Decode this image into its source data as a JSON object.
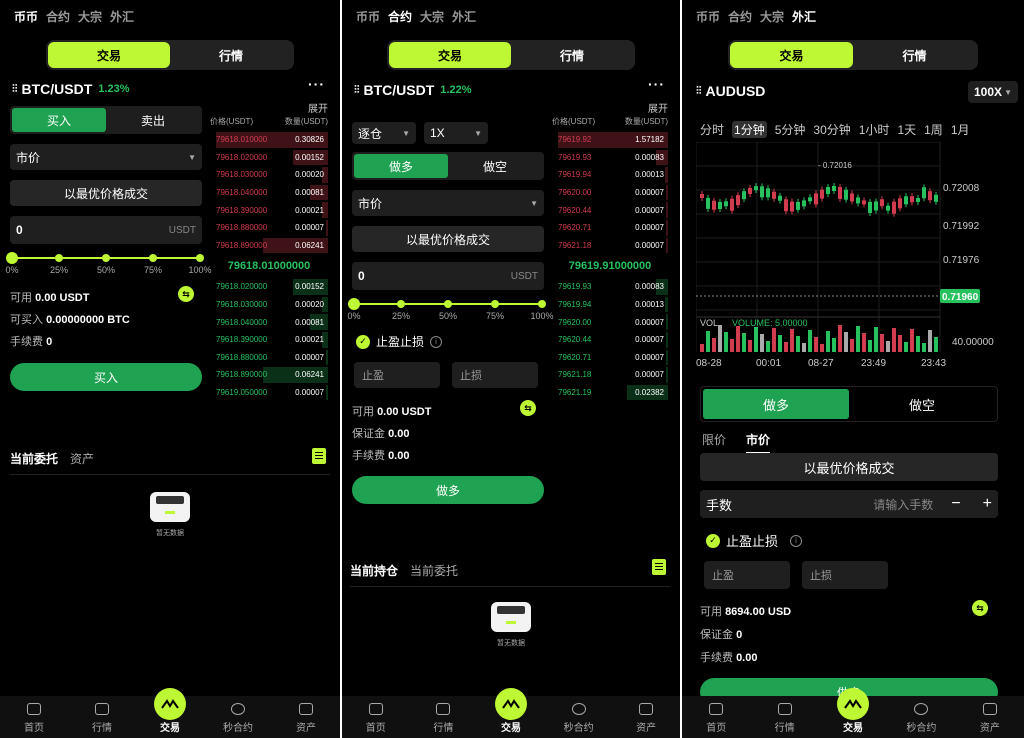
{
  "common": {
    "topnav": [
      "币币",
      "合约",
      "大宗",
      "外汇"
    ],
    "seg": [
      "交易",
      "行情"
    ],
    "bottomnav": [
      "首页",
      "行情",
      "交易",
      "秒合约",
      "资产"
    ],
    "empty_text": "暂无数据",
    "colors": {
      "accent": "#bef733",
      "buy": "#1fa251",
      "up": "#27c15e",
      "down": "#d23c4f"
    }
  },
  "spot": {
    "pair": "BTC/USDT",
    "change": "1.23%",
    "expand": "展开",
    "buy_tab": "买入",
    "sell_tab": "卖出",
    "order_type": "市价",
    "best_price": "以最优价格成交",
    "amount_value": "0",
    "amount_unit": "USDT",
    "slider_labels": [
      "0%",
      "25%",
      "50%",
      "75%",
      "100%"
    ],
    "slider_value": "0%",
    "available_label": "可用",
    "available_value": "0.00 USDT",
    "can_buy_label": "可买入",
    "can_buy_value": "0.00000000  BTC",
    "fee_label": "手续费",
    "fee_value": "0",
    "submit": "买入",
    "ob_header_price": "价格(USDT)",
    "ob_header_qty": "数量(USDT)",
    "asks": [
      {
        "p": "79618.010000",
        "q": "0.30826",
        "d": 0.95
      },
      {
        "p": "79618.020000",
        "q": "0.00152",
        "d": 0.3
      },
      {
        "p": "79618.030000",
        "q": "0.00020",
        "d": 0.05
      },
      {
        "p": "79618.040000",
        "q": "0.00081",
        "d": 0.15
      },
      {
        "p": "79618.390000",
        "q": "0.00021",
        "d": 0.05
      },
      {
        "p": "79618.880000",
        "q": "0.00007",
        "d": 0.02
      },
      {
        "p": "79618.890000",
        "q": "0.06241",
        "d": 0.55
      }
    ],
    "mid_price": "79618.01000000",
    "bids": [
      {
        "p": "79618.020000",
        "q": "0.00152",
        "d": 0.3
      },
      {
        "p": "79618.030000",
        "q": "0.00020",
        "d": 0.05
      },
      {
        "p": "79618.040000",
        "q": "0.00081",
        "d": 0.15
      },
      {
        "p": "79618.390000",
        "q": "0.00021",
        "d": 0.05
      },
      {
        "p": "79618.880000",
        "q": "0.00007",
        "d": 0.02
      },
      {
        "p": "79618.890000",
        "q": "0.06241",
        "d": 0.55
      },
      {
        "p": "79619.050000",
        "q": "0.00007",
        "d": 0.02
      }
    ],
    "sections": [
      "当前委托",
      "资产"
    ]
  },
  "contract": {
    "pair": "BTC/USDT",
    "change": "1.22%",
    "expand": "展开",
    "margin_mode": "逐仓",
    "leverage": "1X",
    "long_tab": "做多",
    "short_tab": "做空",
    "order_type": "市价",
    "best_price": "以最优价格成交",
    "amount_value": "0",
    "amount_unit": "USDT",
    "slider_labels": [
      "0%",
      "25%",
      "50%",
      "75%",
      "100%"
    ],
    "slider_value": "0%",
    "tpsl_label": "止盈止损",
    "tp_placeholder": "止盈",
    "sl_placeholder": "止损",
    "available_label": "可用",
    "available_value": "0.00 USDT",
    "margin_label": "保证金",
    "margin_value": "0.00",
    "fee_label": "手续费",
    "fee_value": "0.00",
    "submit": "做多",
    "ob_header_price": "价格(USDT)",
    "ob_header_qty": "数量(USDT)",
    "asks": [
      {
        "p": "79619.92",
        "q": "1.57182",
        "d": 0.95
      },
      {
        "p": "79619.93",
        "q": "0.00083",
        "d": 0.1
      },
      {
        "p": "79619.94",
        "q": "0.00013",
        "d": 0.03
      },
      {
        "p": "79620.00",
        "q": "0.00007",
        "d": 0.02
      },
      {
        "p": "79620.44",
        "q": "0.00007",
        "d": 0.02
      },
      {
        "p": "79620.71",
        "q": "0.00007",
        "d": 0.02
      },
      {
        "p": "79621.18",
        "q": "0.00007",
        "d": 0.02
      }
    ],
    "mid_price": "79619.91000000",
    "bids": [
      {
        "p": "79619.93",
        "q": "0.00083",
        "d": 0.1
      },
      {
        "p": "79619.94",
        "q": "0.00013",
        "d": 0.03
      },
      {
        "p": "79620.00",
        "q": "0.00007",
        "d": 0.02
      },
      {
        "p": "79620.44",
        "q": "0.00007",
        "d": 0.02
      },
      {
        "p": "79620.71",
        "q": "0.00007",
        "d": 0.02
      },
      {
        "p": "79621.18",
        "q": "0.00007",
        "d": 0.02
      },
      {
        "p": "79621.19",
        "q": "0.02382",
        "d": 0.35
      }
    ],
    "sections": [
      "当前持仓",
      "当前委托"
    ]
  },
  "forex": {
    "pair": "AUDUSD",
    "leverage": "100X",
    "timeframes": [
      "分时",
      "1分钟",
      "5分钟",
      "30分钟",
      "1小时",
      "1天",
      "1周",
      "1月"
    ],
    "active_timeframe": "1分钟",
    "y_ticks": [
      "0.72008",
      "0.71992",
      "0.71976"
    ],
    "last_price": "0.71960",
    "peak_label": "0.72016",
    "vol_label": "VOL",
    "volume_label": "VOLUME: 5.00000",
    "vol_tick": "40.00000",
    "x_ticks": [
      "08-28",
      "00:01",
      "08-27",
      "23:49",
      "23:43"
    ],
    "long_tab": "做多",
    "short_tab": "做空",
    "order_tabs": [
      "限价",
      "市价"
    ],
    "best_price": "以最优价格成交",
    "lots_label": "手数",
    "lots_placeholder": "请输入手数",
    "minus": "−",
    "plus": "+",
    "tpsl_label": "止盈止损",
    "tp_placeholder": "止盈",
    "sl_placeholder": "止损",
    "available_label": "可用",
    "available_value": "8694.00 USD",
    "margin_label": "保证金",
    "margin_value": "0",
    "fee_label": "手续费",
    "fee_value": "0.00",
    "submit": "做多"
  }
}
